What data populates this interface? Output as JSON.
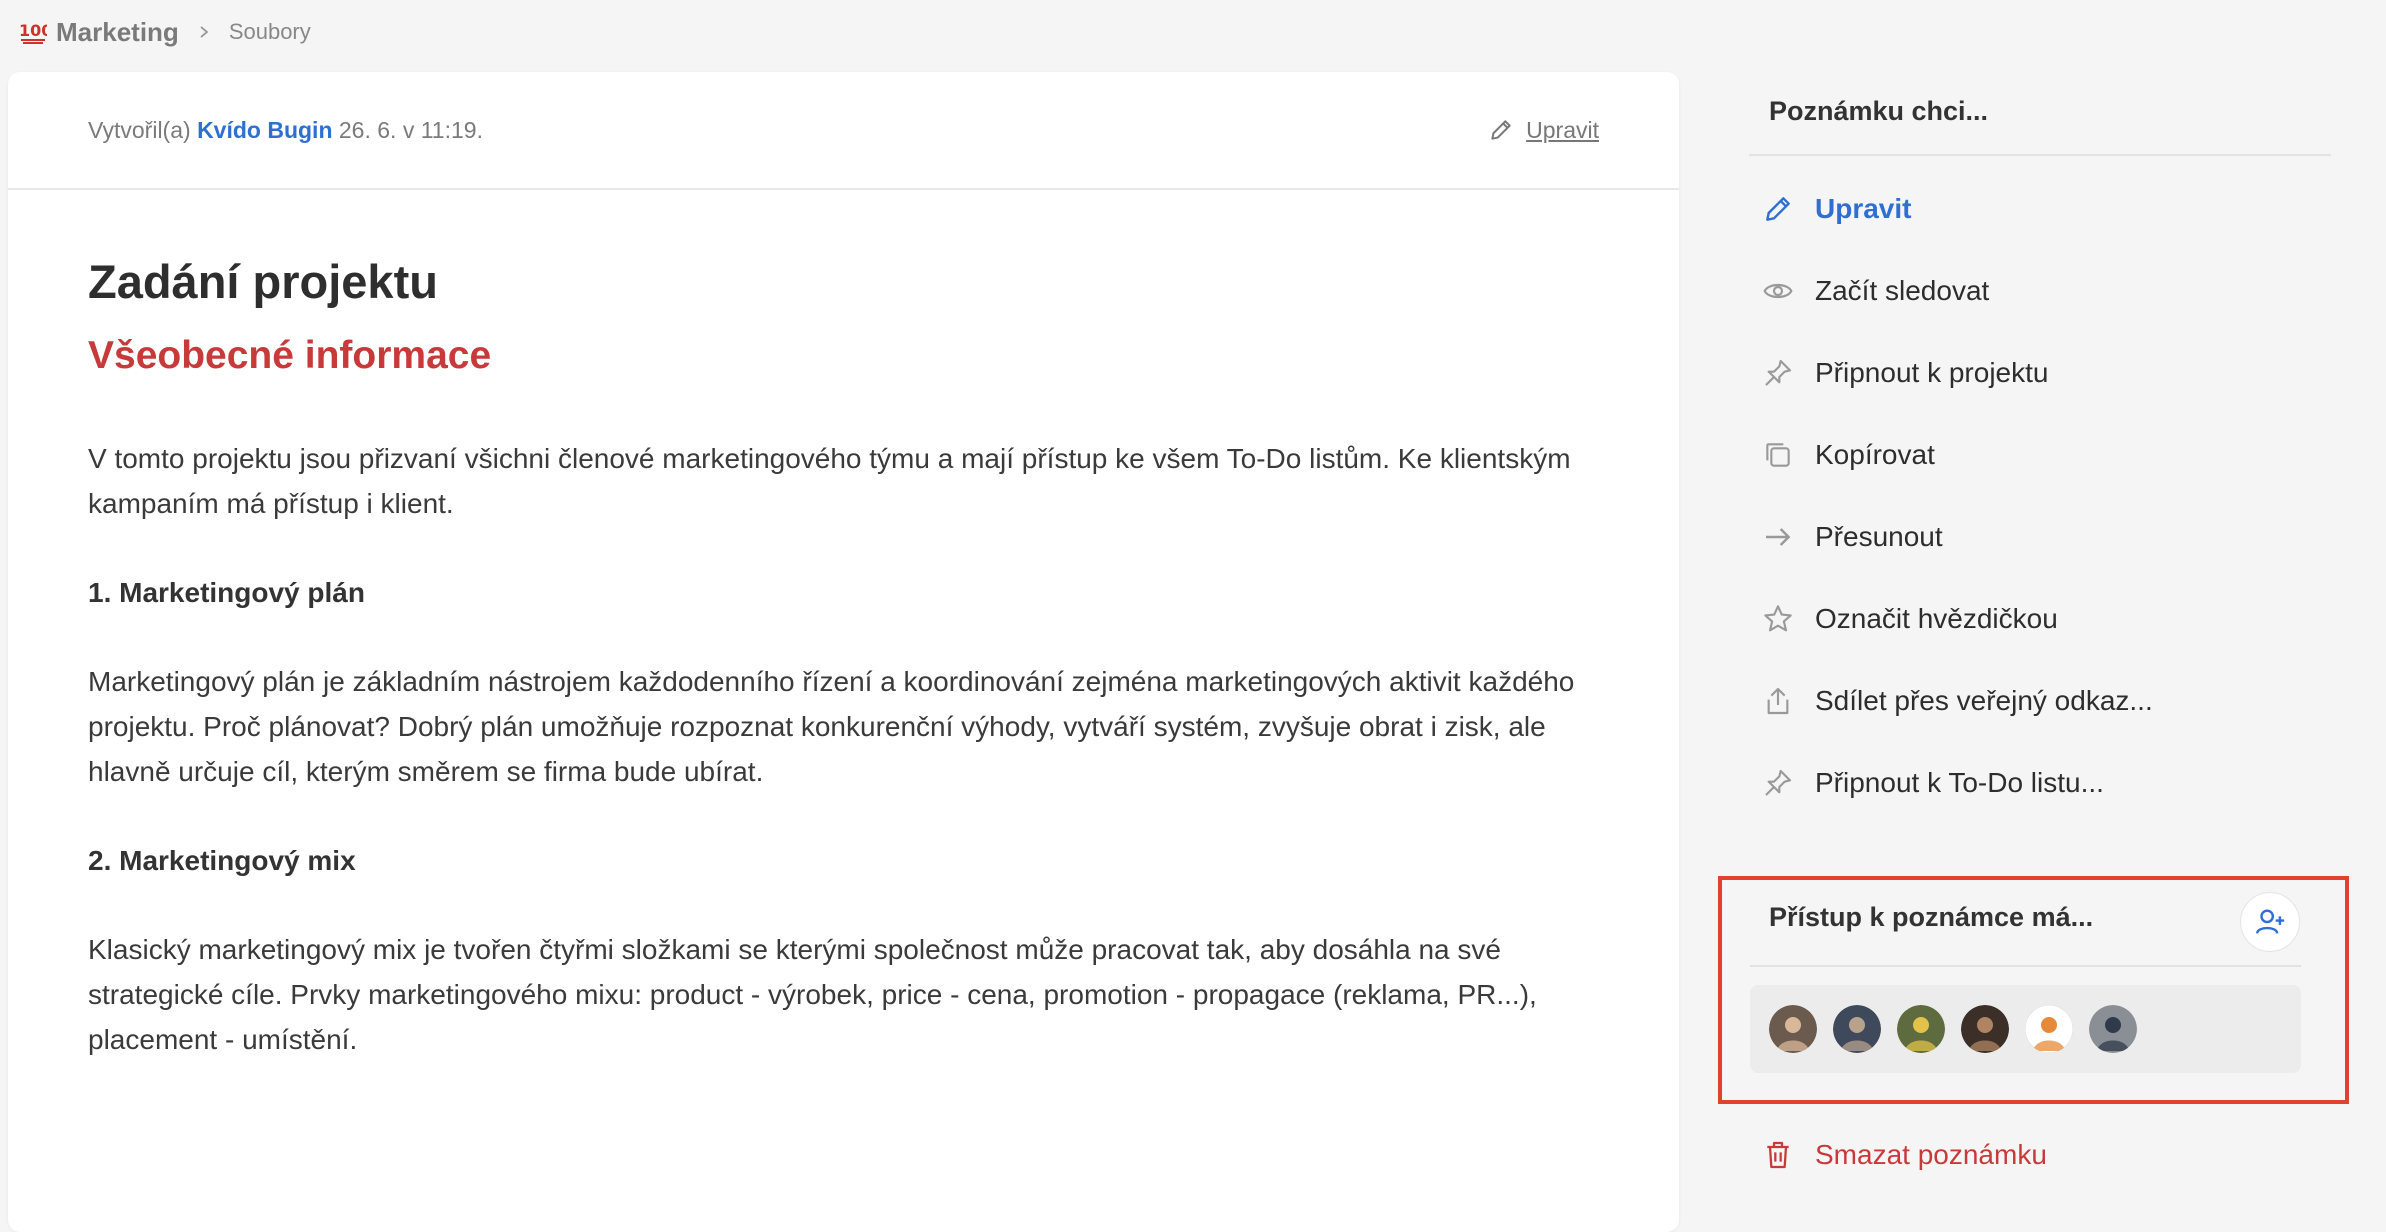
{
  "breadcrumb": {
    "emoji": "💯",
    "project": "Marketing",
    "current": "Soubory"
  },
  "note": {
    "meta_prefix": "Vytvořil(a)",
    "author": "Kvído Bugin",
    "meta_date": "26. 6. v 11:19.",
    "edit_label": "Upravit",
    "title": "Zadání projektu",
    "subtitle": "Všeobecné informace",
    "paragraph1": "V tomto projektu jsou přizvaní všichni členové marketingového týmu a mají přístup ke všem To-Do listům. Ke klientským kampaním má přístup i klient.",
    "section1_heading": "1. Marketingový plán",
    "paragraph2": "Marketingový plán je základním nástrojem každodenního řízení a koordinování zejména marketingových aktivit každého projektu. Proč plánovat? Dobrý plán umožňuje rozpoznat konkurenční výhody, vytváří systém, zvyšuje obrat i zisk, ale hlavně určuje cíl, kterým směrem se firma bude ubírat.",
    "section2_heading": "2. Marketingový mix",
    "paragraph3": "Klasický marketingový mix je tvořen čtyřmi složkami se kterými společnost může pracovat tak, aby dosáhla na své strategické cíle. Prvky marketingového mixu: product - výrobek, price - cena, promotion - propagace (reklama, PR...), placement - umístění."
  },
  "panel": {
    "title": "Poznámku chci...",
    "actions": [
      {
        "label": "Upravit",
        "icon": "pencil-icon"
      },
      {
        "label": "Začít sledovat",
        "icon": "eye-icon"
      },
      {
        "label": "Připnout k projektu",
        "icon": "pin-icon"
      },
      {
        "label": "Kopírovat",
        "icon": "copy-icon"
      },
      {
        "label": "Přesunout",
        "icon": "arrow-right-icon"
      },
      {
        "label": "Označit hvězdičkou",
        "icon": "star-icon"
      },
      {
        "label": "Sdílet přes veřejný odkaz...",
        "icon": "share-icon"
      },
      {
        "label": "Připnout k To-Do listu...",
        "icon": "pin-icon"
      }
    ],
    "access_title": "Přístup k poznámce má...",
    "avatars": [
      {
        "name": "avatar-1",
        "bg": "#6b5a4e",
        "fg": "#d9b89a"
      },
      {
        "name": "avatar-2",
        "bg": "#3e4a5c",
        "fg": "#b9a28c"
      },
      {
        "name": "avatar-3",
        "bg": "#5d6b3e",
        "fg": "#e2c24a"
      },
      {
        "name": "avatar-4",
        "bg": "#3b2f28",
        "fg": "#b08462"
      },
      {
        "name": "avatar-5",
        "bg": "#ffffff",
        "fg": "#e58a3a"
      },
      {
        "name": "avatar-6",
        "bg": "#8a8f96",
        "fg": "#2f3b4a"
      }
    ],
    "delete_label": "Smazat poznámku"
  },
  "colors": {
    "accent_blue": "#2e6fd1",
    "accent_red": "#c83a3a",
    "highlight_border": "#e0422f"
  }
}
